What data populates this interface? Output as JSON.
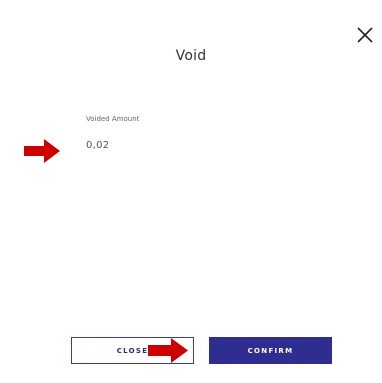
{
  "dialog": {
    "title": "Void",
    "close_icon": "close-icon"
  },
  "field": {
    "label": "Voided Amount",
    "value": "0,02"
  },
  "buttons": {
    "close_label": "CLOSE",
    "confirm_label": "CONFIRM"
  },
  "annotations": {
    "arrow_icon": "arrow-right-icon",
    "arrow_color": "#cc0000"
  },
  "colors": {
    "primary": "#2f2d8f",
    "close_border": "#3b3d9e"
  }
}
